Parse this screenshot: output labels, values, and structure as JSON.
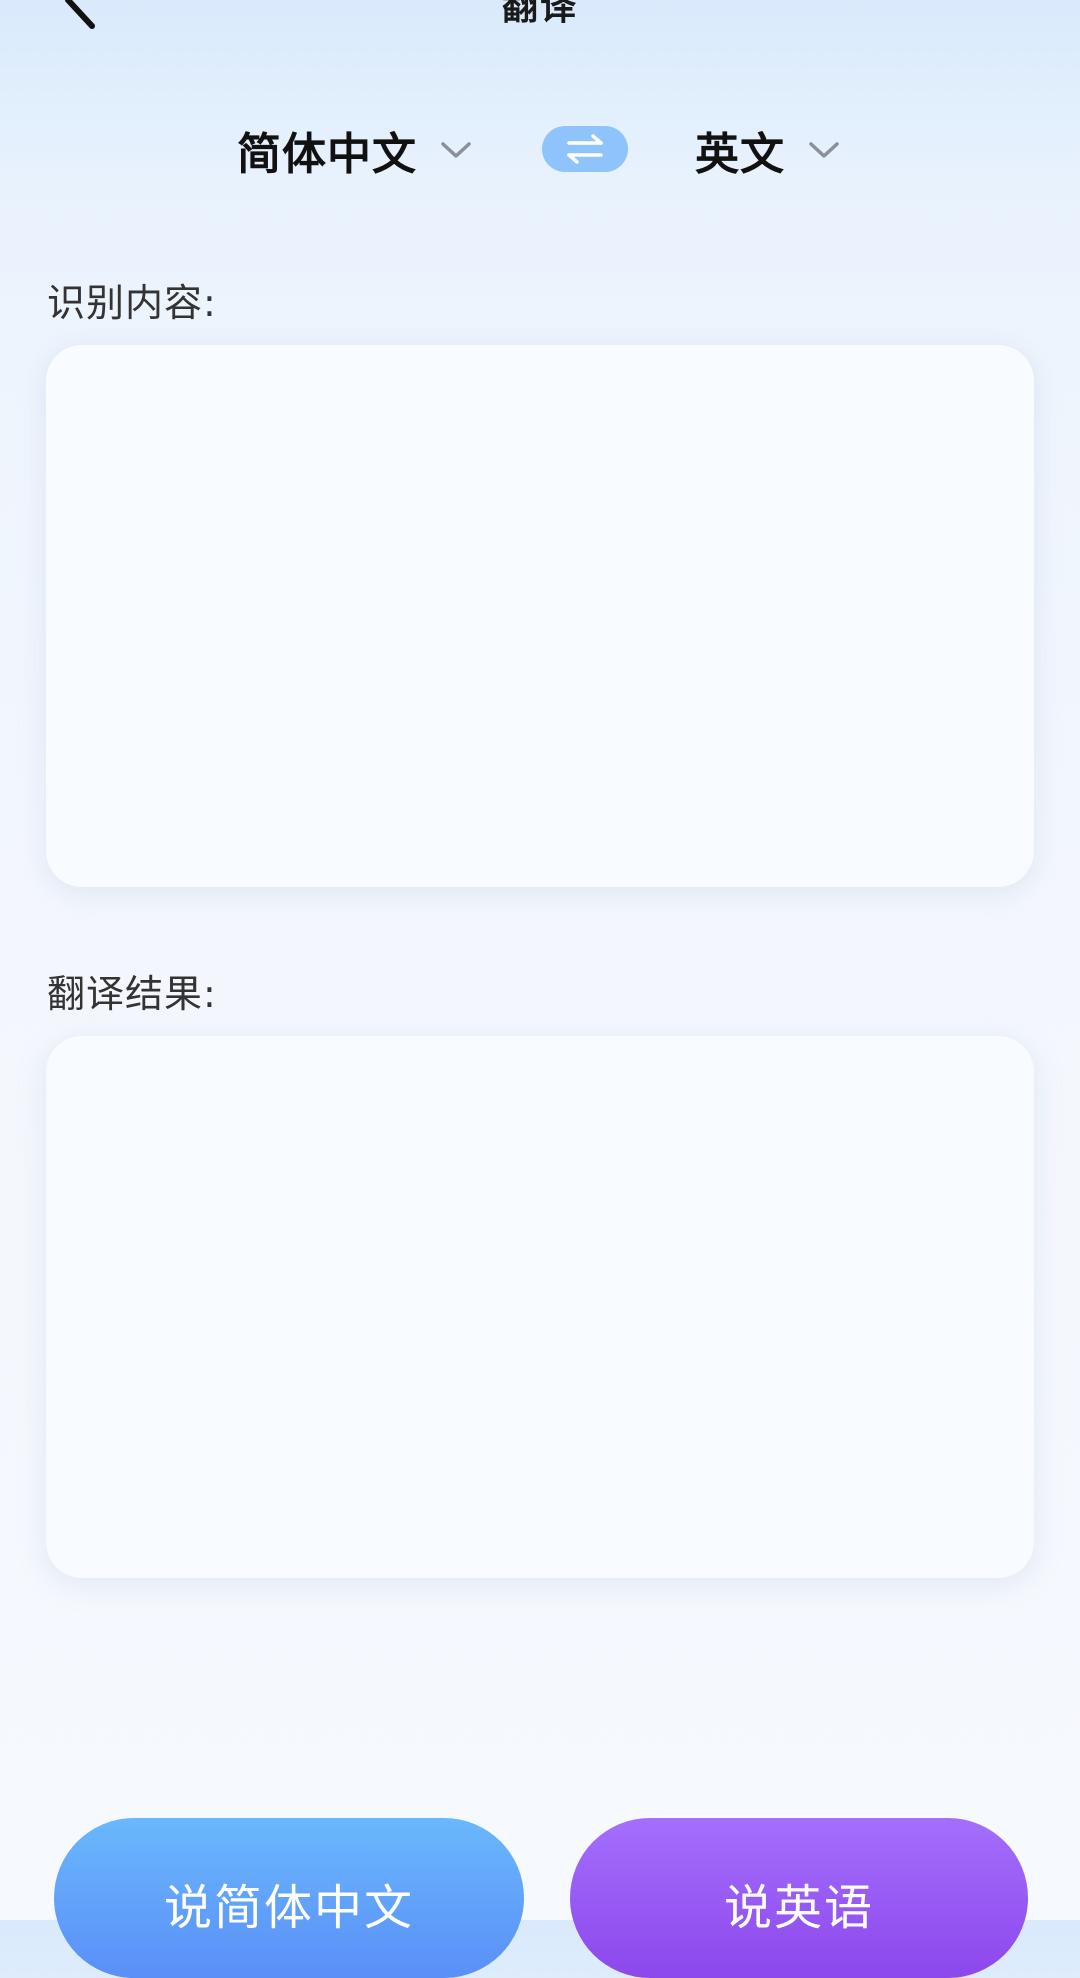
{
  "header": {
    "title": "翻译",
    "back_icon": "chevron-left-icon"
  },
  "language_bar": {
    "source_language": "简体中文",
    "target_language": "英文",
    "dropdown_icon": "chevron-down-icon",
    "swap_icon": "swap-arrows-icon",
    "swap_color": "#8ec3fb"
  },
  "recognized": {
    "label": "识别内容:",
    "content": ""
  },
  "result": {
    "label": "翻译结果:",
    "content": ""
  },
  "actions": {
    "speak_source_label": "说简体中文",
    "speak_target_label": "说英语",
    "speak_source_color": "#6ab8fd",
    "speak_target_color": "#a46ffd"
  }
}
